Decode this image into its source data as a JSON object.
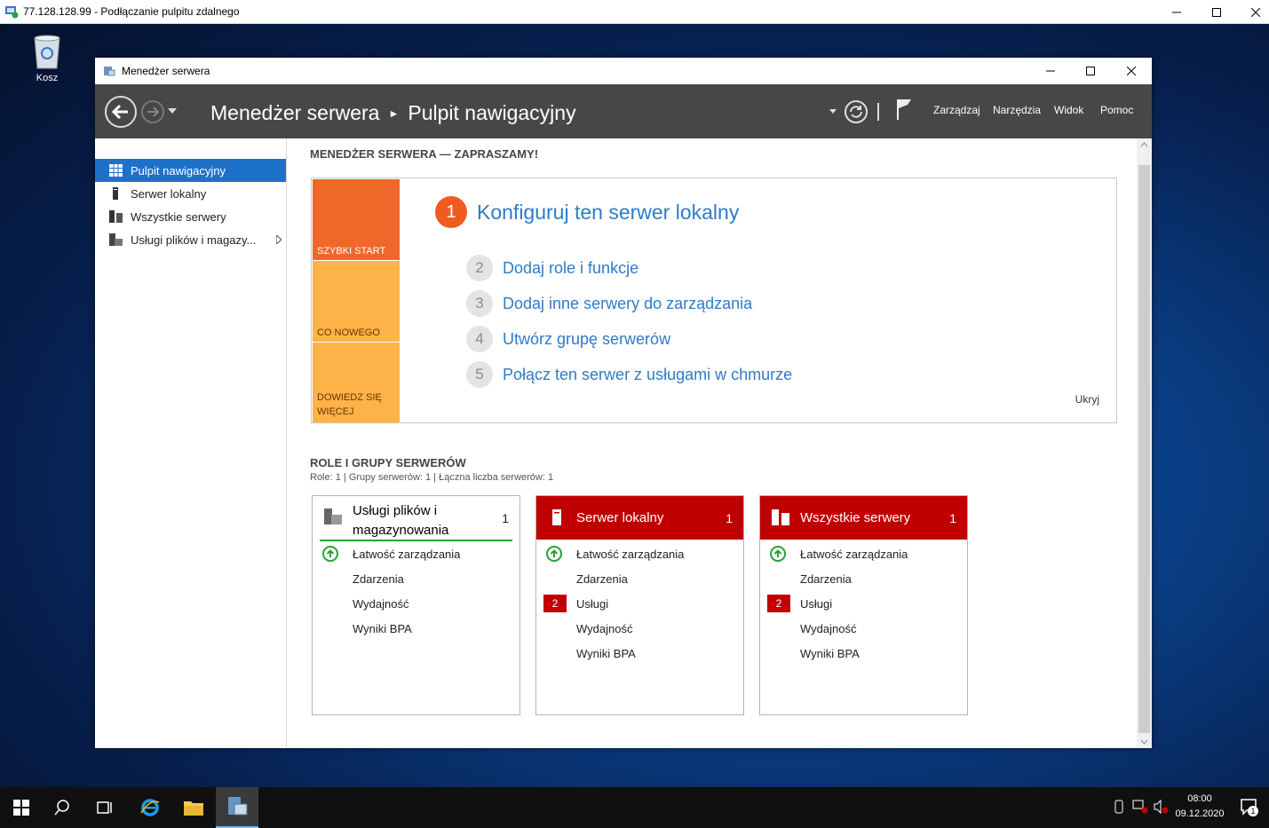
{
  "rdp": {
    "title": "77.128.128.99 - Podłączanie pulpitu zdalnego"
  },
  "desktop": {
    "recycle_label": "Kosz"
  },
  "window": {
    "title": "Menedżer serwera"
  },
  "header": {
    "breadcrumb_root": "Menedżer serwera",
    "breadcrumb_page": "Pulpit nawigacyjny",
    "menus": [
      "Zarządzaj",
      "Narzędzia",
      "Widok",
      "Pomoc"
    ]
  },
  "sidebar": {
    "items": [
      {
        "label": "Pulpit nawigacyjny",
        "icon": "dashboard-grid-icon"
      },
      {
        "label": "Serwer lokalny",
        "icon": "server-icon"
      },
      {
        "label": "Wszystkie serwery",
        "icon": "servers-icon"
      },
      {
        "label": "Usługi plików i magazy...",
        "icon": "file-storage-icon"
      }
    ]
  },
  "welcome": {
    "title": "MENEDŻER SERWERA — ZAPRASZAMY!",
    "tiles": [
      "SZYBKI START",
      "CO NOWEGO",
      "DOWIEDZ SIĘ WIĘCEJ"
    ],
    "steps": [
      {
        "num": "1",
        "label": "Konfiguruj ten serwer lokalny"
      },
      {
        "num": "2",
        "label": "Dodaj role i funkcje"
      },
      {
        "num": "3",
        "label": "Dodaj inne serwery do zarządzania"
      },
      {
        "num": "4",
        "label": "Utwórz grupę serwerów"
      },
      {
        "num": "5",
        "label": "Połącz ten serwer z usługami w chmurze"
      }
    ],
    "hide": "Ukryj"
  },
  "roles": {
    "title": "ROLE I GRUPY SERWERÓW",
    "summary": "Role: 1 | Grupy serwerów: 1 | Łączna liczba serwerów: 1",
    "cards": [
      {
        "title_line1": "Usługi plików i",
        "title_line2": "magazynowania",
        "count": "1",
        "rows": [
          "Łatwość zarządzania",
          "Zdarzenia",
          "Wydajność",
          "Wyniki BPA"
        ]
      },
      {
        "title": "Serwer lokalny",
        "count": "1",
        "rows": [
          "Łatwość zarządzania",
          "Zdarzenia",
          "Usługi",
          "Wydajność",
          "Wyniki BPA"
        ],
        "badge": "2"
      },
      {
        "title": "Wszystkie serwery",
        "count": "1",
        "rows": [
          "Łatwość zarządzania",
          "Zdarzenia",
          "Usługi",
          "Wydajność",
          "Wyniki BPA"
        ],
        "badge": "2"
      }
    ]
  },
  "taskbar": {
    "time": "08:00",
    "date": "09.12.2020",
    "notif_count": "1"
  },
  "colors": {
    "accent": "#1e71c9",
    "orange": "#f05b1f",
    "red": "#c00000",
    "ok": "#2aa134"
  }
}
